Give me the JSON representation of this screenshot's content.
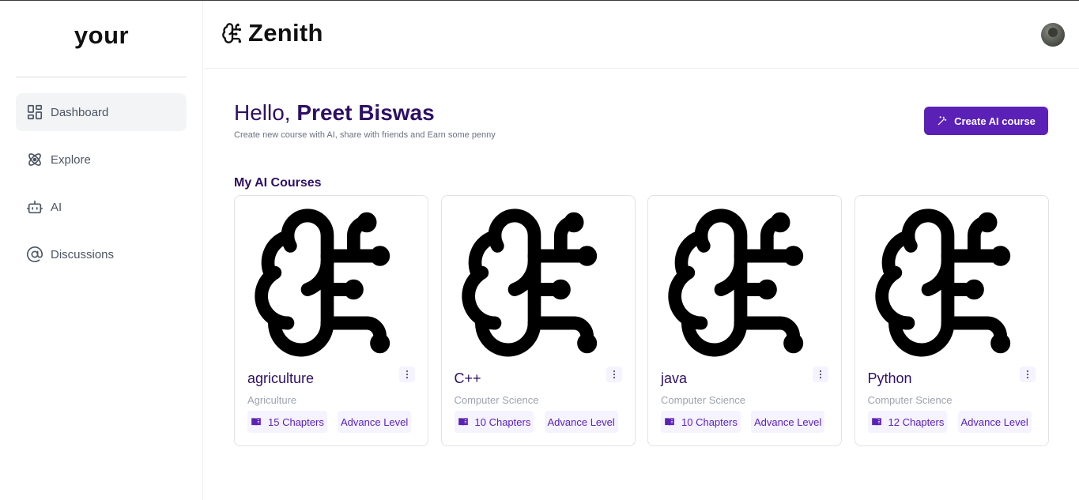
{
  "sidebar": {
    "brand": "your",
    "items": [
      {
        "label": "Dashboard",
        "icon": "dashboard-icon",
        "active": true
      },
      {
        "label": "Explore",
        "icon": "atom-icon",
        "active": false
      },
      {
        "label": "AI",
        "icon": "robot-icon",
        "active": false
      },
      {
        "label": "Discussions",
        "icon": "at-sign-icon",
        "active": false
      }
    ]
  },
  "header": {
    "logo_text": "Zenith",
    "logo_icon": "brain-circuit-icon",
    "avatar": "user-avatar"
  },
  "main": {
    "greeting_hello": "Hello,",
    "greeting_name": "Preet Biswas",
    "subtitle": "Create new course with AI, share with friends and Earn some penny",
    "create_button": "Create AI course",
    "section_title": "My AI Courses",
    "courses": [
      {
        "title": "agriculture",
        "category": "Agriculture",
        "chapters": "15 Chapters",
        "level": "Advance Level"
      },
      {
        "title": "C++",
        "category": "Computer Science",
        "chapters": "10 Chapters",
        "level": "Advance Level"
      },
      {
        "title": "java",
        "category": "Computer Science",
        "chapters": "10 Chapters",
        "level": "Advance Level"
      },
      {
        "title": "Python",
        "category": "Computer Science",
        "chapters": "12 Chapters",
        "level": "Advance Level"
      }
    ]
  },
  "colors": {
    "accent": "#5b21b6",
    "heading": "#2e1065",
    "pill_bg": "#f5f3ff"
  }
}
